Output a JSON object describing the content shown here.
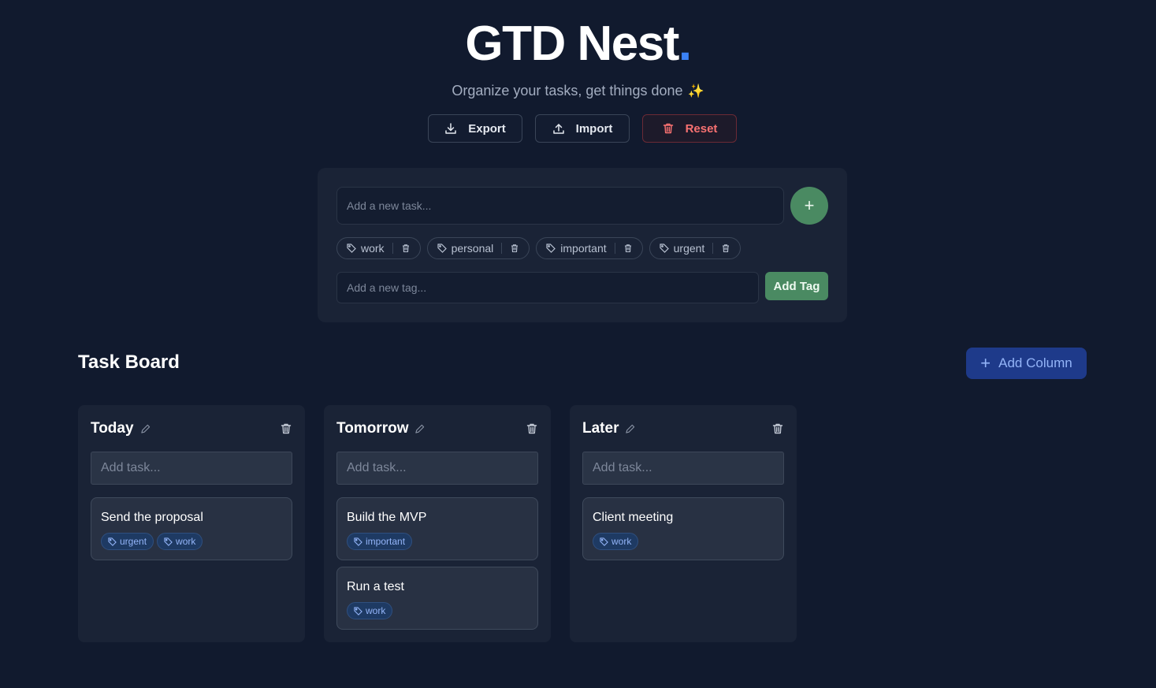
{
  "header": {
    "title": "GTD Nest",
    "title_dot": ".",
    "subtitle": "Organize your tasks, get things done",
    "sparkle": "✨"
  },
  "actions": {
    "export_label": "Export",
    "import_label": "Import",
    "reset_label": "Reset"
  },
  "composer": {
    "task_placeholder": "Add a new task...",
    "add_button": "+",
    "tags": [
      {
        "label": "work"
      },
      {
        "label": "personal"
      },
      {
        "label": "important"
      },
      {
        "label": "urgent"
      }
    ],
    "tag_placeholder": "Add a new tag...",
    "add_tag_label": "Add Tag"
  },
  "board": {
    "title": "Task Board",
    "add_column_label": "Add Column",
    "add_column_icon": "+",
    "task_placeholder": "Add task...",
    "columns": [
      {
        "name": "Today",
        "cards": [
          {
            "title": "Send the proposal",
            "tags": [
              "urgent",
              "work"
            ]
          }
        ]
      },
      {
        "name": "Tomorrow",
        "cards": [
          {
            "title": "Build the MVP",
            "tags": [
              "important"
            ]
          },
          {
            "title": "Run a test",
            "tags": [
              "work"
            ]
          }
        ]
      },
      {
        "name": "Later",
        "cards": [
          {
            "title": "Client meeting",
            "tags": [
              "work"
            ]
          }
        ]
      }
    ]
  },
  "colors": {
    "background": "#111a2e",
    "panel": "#1a2336",
    "accent_blue": "#3b82f6",
    "accent_green": "#4a8a62",
    "danger": "#f87171",
    "tag_text": "#93b4f8"
  }
}
